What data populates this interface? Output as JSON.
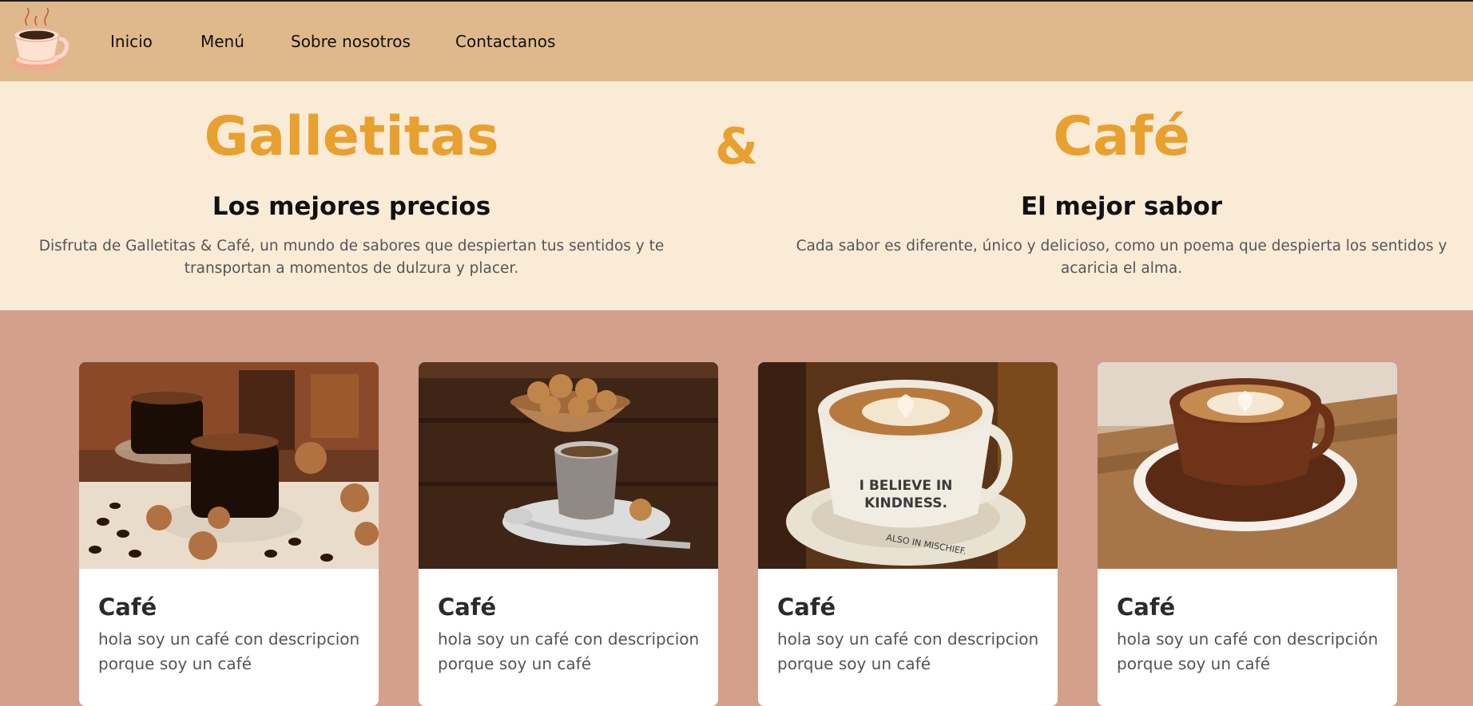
{
  "nav": {
    "logo": "coffee-cup-logo",
    "links": [
      "Inicio",
      "Menú",
      "Sobre nosotros",
      "Contactanos"
    ]
  },
  "hero": {
    "title_left": "Galletitas",
    "ampersand": "&",
    "title_right": "Café",
    "left": {
      "subtitle": "Los mejores precios",
      "text": "Disfruta de Galletitas & Café, un mundo de sabores que despiertan tus sentidos y te transportan a momentos de dulzura y placer."
    },
    "right": {
      "subtitle": "El mejor sabor",
      "text": "Cada sabor es diferente, único y delicioso, como un poema que despierta los sentidos y acaricia el alma."
    }
  },
  "cards": [
    {
      "title": "Café",
      "text": "hola soy un café con descripcion porque soy un café",
      "image": "espresso-with-cookies-photo"
    },
    {
      "title": "Café",
      "text": "hola soy un café con descripcion porque soy un café",
      "image": "coffee-cup-with-amaretti-bowl-photo"
    },
    {
      "title": "Café",
      "text": "hola soy un café con descripcion porque soy un café",
      "image": "latte-art-kindness-mug-photo"
    },
    {
      "title": "Café",
      "text": "hola soy un café con descripción porque soy un café",
      "image": "latte-art-brown-cup-photo"
    }
  ],
  "colors": {
    "navbar": "#dfb98c",
    "hero_bg": "#faebd7",
    "accent": "#e8a02e",
    "page_bg": "#d2a08b",
    "card_bg": "#ffffff"
  }
}
